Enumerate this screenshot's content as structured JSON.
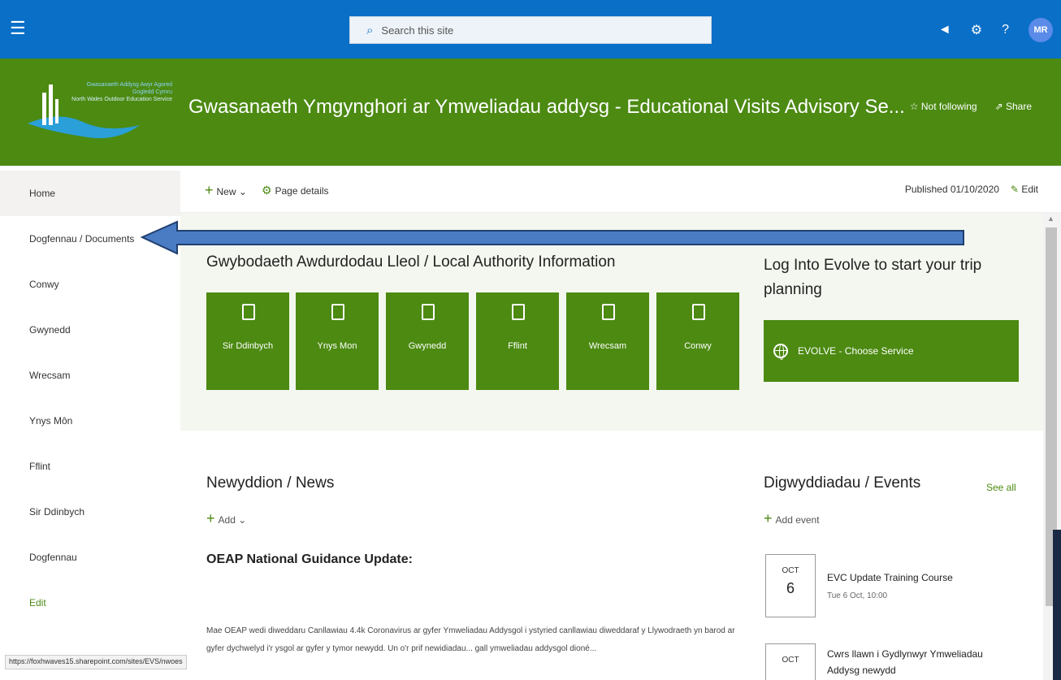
{
  "suitebar": {
    "search_placeholder": "Search this site",
    "avatar_initials": "MR"
  },
  "header": {
    "logo_line1": "Gwasanaeth Addysg Awyr Agored Gogledd Cymru",
    "logo_line2": "North Wales Outdoor Education Service",
    "site_title": "Gwasanaeth Ymgynghori ar Ymweliadau addysg - Educational Visits Advisory Se...",
    "not_following": "Not following",
    "share": "Share"
  },
  "nav": {
    "items": [
      {
        "label": "Home"
      },
      {
        "label": "Dogfennau / Documents"
      },
      {
        "label": "Conwy"
      },
      {
        "label": "Gwynedd"
      },
      {
        "label": "Wrecsam"
      },
      {
        "label": "Ynys Môn"
      },
      {
        "label": "Fflint"
      },
      {
        "label": "Sir Ddinbych"
      },
      {
        "label": "Dogfennau"
      }
    ],
    "edit": "Edit"
  },
  "commandbar": {
    "new": "New",
    "page_details": "Page details",
    "published": "Published 01/10/2020",
    "edit": "Edit"
  },
  "local_authority": {
    "title": "Gwybodaeth Awdurdodau Lleol / Local Authority Information",
    "tiles": [
      "Sir Ddinbych",
      "Ynys Mon",
      "Gwynedd",
      "Fflint",
      "Wrecsam",
      "Conwy"
    ]
  },
  "evolve": {
    "title": "Log Into Evolve to start your trip planning",
    "button": "EVOLVE - Choose Service"
  },
  "news": {
    "title": "Newyddion / News",
    "add": "Add",
    "item_title": "OEAP National Guidance Update:",
    "body": "Mae OEAP wedi diweddaru Canllawiau 4.4k Coronavirus ar gyfer Ymweliadau Addysgol i ystyried canllawiau diweddaraf y Llywodraeth yn barod ar gyfer dychwelyd i'r ysgol ar gyfer y tymor newydd. Un o'r prif newidiadau... gall ymweliadau addysgol dioné..."
  },
  "events": {
    "title": "Digwyddiadau / Events",
    "see_all": "See all",
    "add_event": "Add event",
    "items": [
      {
        "month": "OCT",
        "day": "6",
        "title": "EVC Update Training Course",
        "sub": "Tue 6 Oct, 10:00"
      },
      {
        "month": "OCT",
        "day": "",
        "title": "Cwrs llawn i Gydlynwyr Ymweliadau",
        "sub": "Addysg newydd"
      }
    ]
  },
  "status_url": "https://foxhwaves15.sharepoint.com/sites/EVS/nwoes"
}
